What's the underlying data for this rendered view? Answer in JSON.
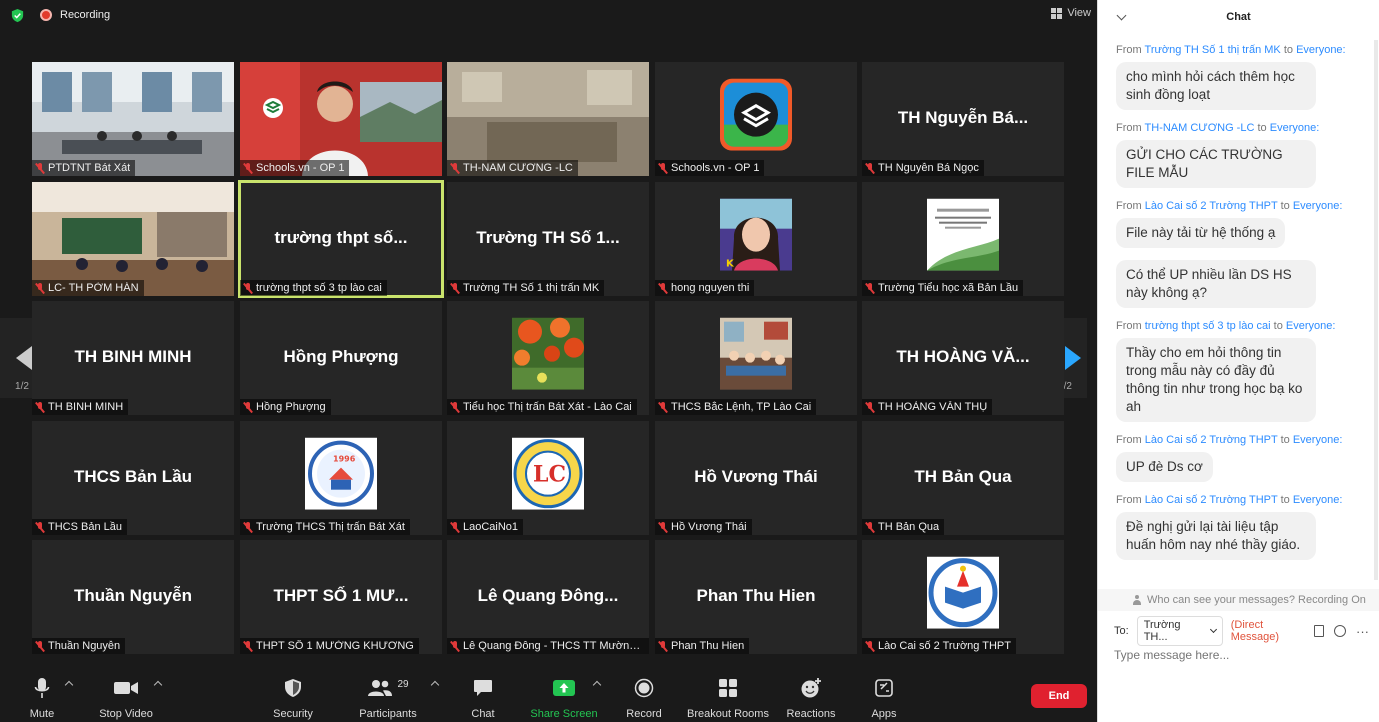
{
  "topbar": {
    "recording_label": "Recording",
    "view_label": "View"
  },
  "tiles": [
    {
      "kind": "photo",
      "photo": "classroom",
      "label": "PTDTNT Bát Xát"
    },
    {
      "kind": "photo",
      "photo": "presenter",
      "label": "Schools.vn - OP 1"
    },
    {
      "kind": "photo",
      "photo": "room-blur",
      "label": "TH-NAM CƯƠNG -LC"
    },
    {
      "kind": "avatar",
      "avatar": "schools-logo",
      "label": "Schools.vn - OP 1"
    },
    {
      "kind": "name",
      "name": "TH Nguyễn Bá...",
      "label": "TH Nguyễn Bá Ngọc"
    },
    {
      "kind": "photo",
      "photo": "classroom2",
      "label": "LC- TH PỜM HÁN"
    },
    {
      "kind": "name",
      "name": "trường thpt số...",
      "label": "trường thpt số 3 tp lào cai",
      "active": true
    },
    {
      "kind": "name",
      "name": "Trường TH Số 1...",
      "label": "Trường TH Số 1  thị trấn MK"
    },
    {
      "kind": "avatar",
      "avatar": "girl-portrait",
      "label": "hong nguyen thi"
    },
    {
      "kind": "avatar",
      "avatar": "document",
      "label": "Trường Tiểu học xã Bản Lầu"
    },
    {
      "kind": "name",
      "name": "TH BINH MINH",
      "label": "TH BINH MINH"
    },
    {
      "kind": "name",
      "name": "Hồng Phượng",
      "label": "Hồng Phượng"
    },
    {
      "kind": "avatar",
      "avatar": "flowers",
      "label": "Tiểu học Thị trấn Bát Xát - Lào Cai"
    },
    {
      "kind": "avatar",
      "avatar": "meeting-room",
      "label": "THCS Bắc Lệnh, TP Lào Cai"
    },
    {
      "kind": "name",
      "name": "TH HOÀNG VĂ...",
      "label": "TH HOÀNG VĂN THỤ"
    },
    {
      "kind": "name",
      "name": "THCS Bản Lầu",
      "label": "THCS Bản Lầu"
    },
    {
      "kind": "avatar",
      "avatar": "school-emblem",
      "label": "Trường THCS Thị trấn Bát Xát"
    },
    {
      "kind": "avatar",
      "avatar": "round-logo",
      "label": "LaoCaiNo1"
    },
    {
      "kind": "name",
      "name": "Hồ Vương Thái",
      "label": "Hồ Vương Thái"
    },
    {
      "kind": "name",
      "name": "TH Bản Qua",
      "label": "TH Bản Qua"
    },
    {
      "kind": "name",
      "name": "Thuần Nguyễn",
      "label": "Thuần Nguyễn"
    },
    {
      "kind": "name",
      "name": "THPT SỐ 1 MƯ...",
      "label": "THPT SỐ 1 MƯỜNG KHƯƠNG"
    },
    {
      "kind": "name",
      "name": "Lê Quang Đông...",
      "label": "Lê Quang Đông - THCS TT Mường..."
    },
    {
      "kind": "name",
      "name": "Phan Thu Hien",
      "label": "Phan Thu Hien"
    },
    {
      "kind": "avatar",
      "avatar": "book-logo",
      "label": "Lào Cai số 2 Trường THPT"
    }
  ],
  "pagination": {
    "left": "1/2",
    "right": "1/2"
  },
  "toolbar": {
    "mute": "Mute",
    "stop_video": "Stop Video",
    "security": "Security",
    "participants": "Participants",
    "participants_count": "29",
    "chat": "Chat",
    "share_screen": "Share Screen",
    "record": "Record",
    "breakout_rooms": "Breakout Rooms",
    "reactions": "Reactions",
    "apps": "Apps",
    "end": "End"
  },
  "colors": {
    "accent": "#2d8cff",
    "end": "#e0212f",
    "share": "#23c552",
    "active_border": "#c9e36c"
  },
  "chat": {
    "title": "Chat",
    "from_prefix": "From",
    "to_word": "to",
    "messages": [
      {
        "from": "Trường TH Số 1  thị trấn MK",
        "to": "Everyone:",
        "texts": [
          "cho mình hỏi cách thêm học sinh đồng loạt"
        ]
      },
      {
        "from": "TH-NAM CƯƠNG -LC",
        "to": "Everyone:",
        "texts": [
          "GỬI CHO CÁC TRƯỜNG FILE MẪU"
        ]
      },
      {
        "from": "Lào Cai số 2 Trường THPT",
        "to": "Everyone:",
        "texts": [
          "File này tải từ hệ thống ạ",
          "Có thể UP nhiều lần DS HS này không ạ?"
        ]
      },
      {
        "from": "trường thpt số 3 tp lào cai",
        "to": "Everyone:",
        "texts": [
          "Thầy cho em hỏi thông tin trong mẫu này có đầy đủ thông tin như trong học bạ ko ah"
        ]
      },
      {
        "from": "Lào Cai số 2 Trường THPT",
        "to": "Everyone:",
        "texts": [
          "UP đè Ds cơ"
        ]
      },
      {
        "from": "Lào Cai số 2 Trường THPT",
        "to": "Everyone:",
        "texts": [
          "Đề nghị gửi lại tài liệu tập huấn hôm nay nhé thầy giáo."
        ]
      }
    ],
    "visibility_note": "Who can see your messages? Recording On",
    "to_label": "To:",
    "recipient": "Trường TH...",
    "direct_message": "(Direct Message)",
    "more": "···",
    "input_placeholder": "Type message here..."
  }
}
